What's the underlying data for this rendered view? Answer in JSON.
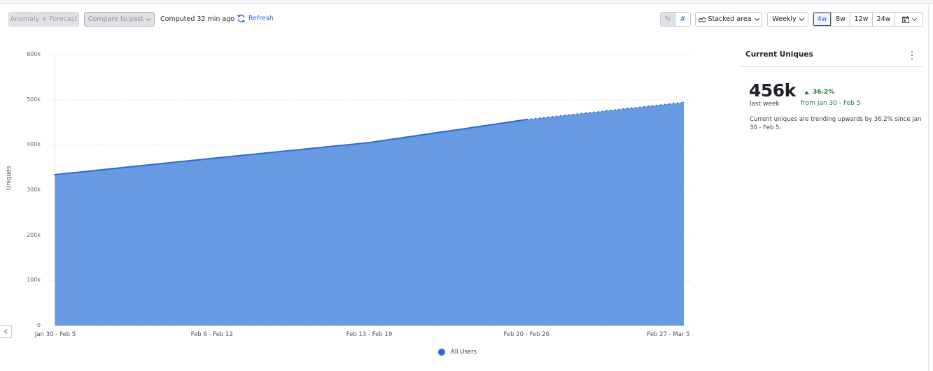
{
  "toolbar": {
    "anomaly_label": "Anomaly + Forecast",
    "compare_label": "Compare to past",
    "computed_text": "Computed 32 min ago",
    "refresh_label": "Refresh",
    "percent_label": "%",
    "number_label": "#",
    "chart_type_label": "Stacked area",
    "interval_label": "Weekly",
    "ranges": [
      "4w",
      "8w",
      "12w",
      "24w"
    ],
    "active_range": "4w"
  },
  "panel": {
    "title": "Current Uniques",
    "value": "456k",
    "value_caption": "last week",
    "change": "36.2%",
    "change_direction": "up",
    "change_caption": "from Jan 30 - Feb 5",
    "description": "Current uniques are trending upwards by 36.2% since Jan 30 - Feb 5."
  },
  "colors": {
    "accent": "#2467d6",
    "series_fill": "#6899e3",
    "series_line": "#2c6ad6",
    "positive": "#1f7a3f"
  },
  "chart_data": {
    "type": "area",
    "title": "",
    "xlabel": "",
    "ylabel": "Uniques",
    "categories": [
      "Jan 30 - Feb 5",
      "Feb 6 - Feb 12",
      "Feb 13 - Feb 19",
      "Feb 20 - Feb 26",
      "Feb 27 - Mar 5"
    ],
    "series": [
      {
        "name": "All Users",
        "values": [
          334000,
          370000,
          405000,
          456000,
          494000
        ],
        "incomplete_from_index": 3
      }
    ],
    "ylim": [
      0,
      600000
    ],
    "yticks": [
      0,
      100000,
      200000,
      300000,
      400000,
      500000,
      600000
    ],
    "ytick_labels": [
      "0",
      "100k",
      "200k",
      "300k",
      "400k",
      "500k",
      "600k"
    ],
    "grid": true,
    "legend_position": "bottom-center",
    "stacked": true
  }
}
